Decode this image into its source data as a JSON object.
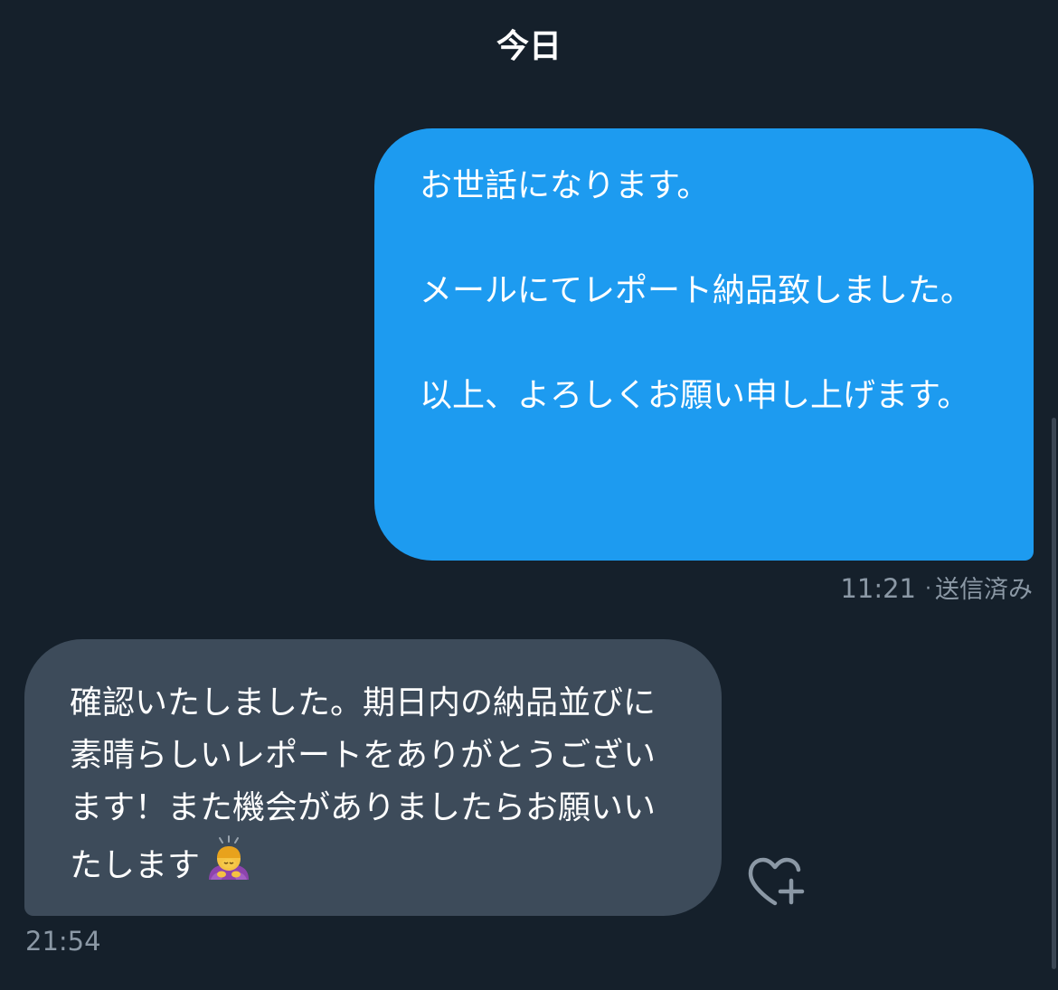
{
  "day_separator": "今日",
  "messages": {
    "outgoing": {
      "text": "お世話になります。\n\nメールにてレポート納品致しました。\n\n以上、よろしくお願い申し上げます。",
      "time": "11:21",
      "separator": "·",
      "status": "送信済み",
      "color": "#1d9bf0"
    },
    "incoming": {
      "text": "確認いたしました。期日内の納品並びに素晴らしいレポートをありがとうございます！また機会がありましたらお願いいたします",
      "emoji": "person-bowing-emoji",
      "time": "21:54",
      "color": "#3d4b5a"
    }
  },
  "actions": {
    "react_icon": "heart-plus-icon"
  },
  "colors": {
    "background": "#15202b",
    "meta_text": "#8b98a5"
  }
}
